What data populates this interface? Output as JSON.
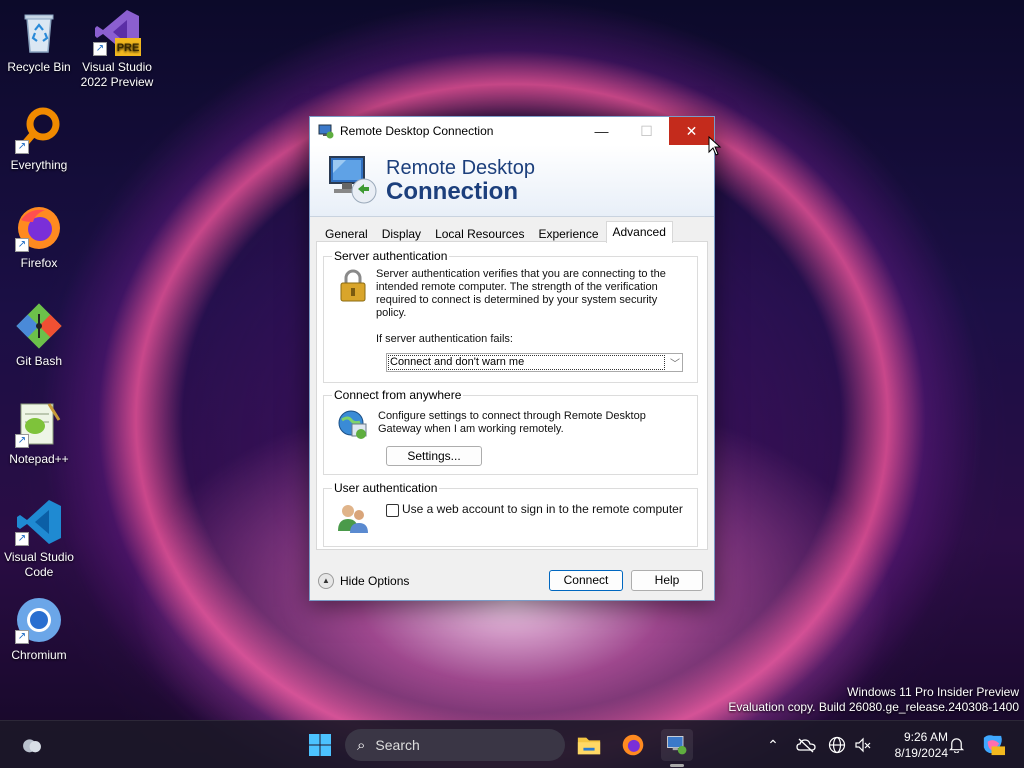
{
  "desktop": {
    "icons": [
      {
        "label": "Recycle Bin"
      },
      {
        "label": "Visual Studio 2022 Preview",
        "badge": "PRE"
      },
      {
        "label": "Everything"
      },
      {
        "label": "Firefox"
      },
      {
        "label": "Git Bash"
      },
      {
        "label": "Notepad++"
      },
      {
        "label": "Visual Studio Code"
      },
      {
        "label": "Chromium"
      }
    ],
    "watermark": {
      "line1": "Windows 11 Pro Insider Preview",
      "line2": "Evaluation copy. Build 26080.ge_release.240308-1400"
    }
  },
  "window": {
    "title": "Remote Desktop Connection",
    "controls": {
      "minimize": "—",
      "maximize": "☐",
      "close": "✕"
    },
    "banner": {
      "line1": "Remote Desktop",
      "line2": "Connection"
    },
    "tabs": [
      {
        "label": "General"
      },
      {
        "label": "Display"
      },
      {
        "label": "Local Resources"
      },
      {
        "label": "Experience"
      },
      {
        "label": "Advanced",
        "active": true
      }
    ],
    "server_auth": {
      "title": "Server authentication",
      "description": "Server authentication verifies that you are connecting to the intended remote computer. The strength of the verification required to connect is determined by your system security policy.",
      "fail_label": "If server authentication fails:",
      "selected": "Connect and don't warn me"
    },
    "connect_anywhere": {
      "title": "Connect from anywhere",
      "description": "Configure settings to connect through Remote Desktop Gateway when I am working remotely.",
      "settings_button": "Settings..."
    },
    "user_auth": {
      "title": "User authentication",
      "checkbox_label": "Use a web account to sign in to the remote computer",
      "checked": false
    },
    "footer": {
      "hide_options": "Hide Options",
      "connect": "Connect",
      "help": "Help"
    }
  },
  "taskbar": {
    "search_placeholder": "Search",
    "time": "9:26 AM",
    "date": "8/19/2024"
  },
  "colors": {
    "accent": "#0067c0",
    "close_red": "#c42b1c",
    "banner_text": "#1c3f7c"
  }
}
